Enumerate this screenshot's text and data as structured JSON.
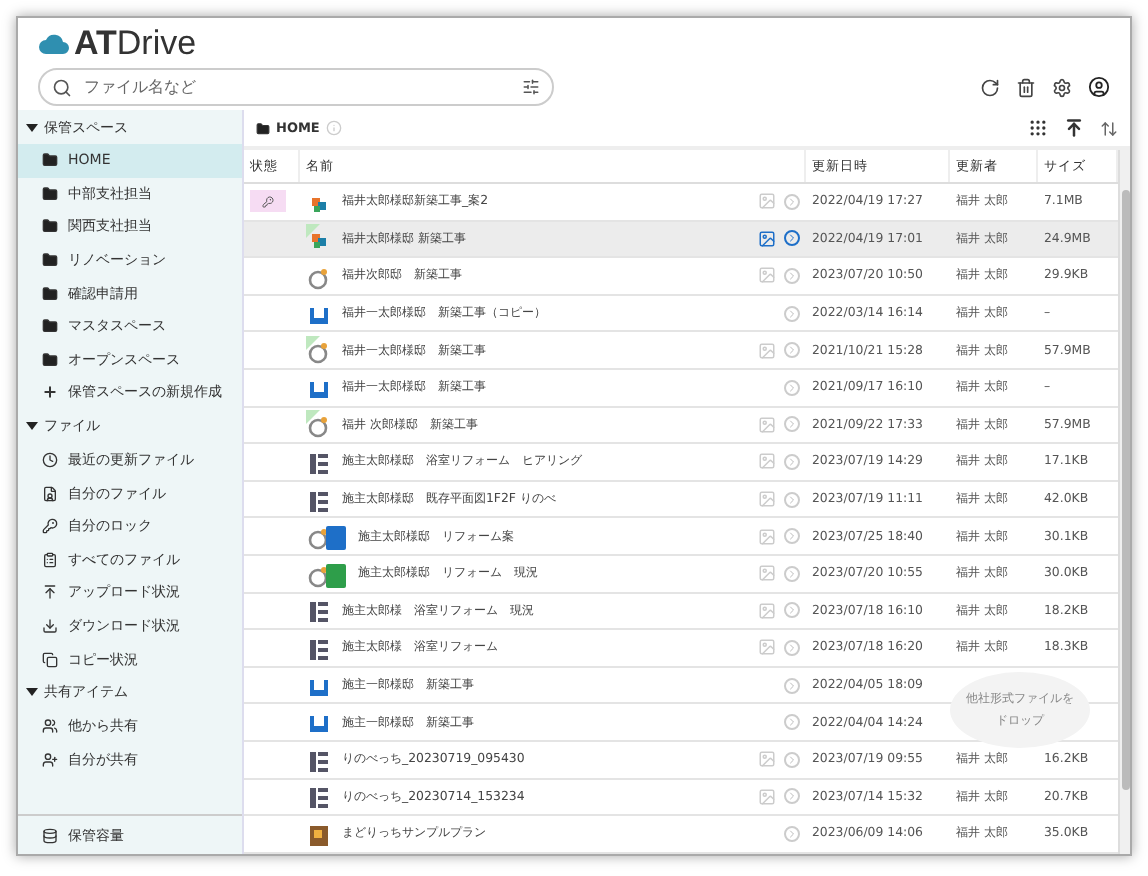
{
  "app": {
    "logo": "ATDrive"
  },
  "search": {
    "placeholder": "ファイル名など"
  },
  "sidebar": {
    "sections": [
      {
        "title": "保管スペース",
        "expanded": true,
        "items": [
          {
            "label": "HOME",
            "kind": "folder",
            "selected": true
          },
          {
            "label": "中部支社担当",
            "kind": "folder",
            "selected": false
          },
          {
            "label": "関西支社担当",
            "kind": "folder",
            "selected": false
          },
          {
            "label": "リノベーション",
            "kind": "folder",
            "selected": false
          },
          {
            "label": "確認申請用",
            "kind": "folder",
            "selected": false
          },
          {
            "label": "マスタスペース",
            "kind": "folder",
            "selected": false
          },
          {
            "label": "オープンスペース",
            "kind": "folder",
            "selected": false
          },
          {
            "label": "保管スペースの新規作成",
            "kind": "add",
            "selected": false
          }
        ]
      },
      {
        "title": "ファイル",
        "expanded": true,
        "items": [
          {
            "label": "最近の更新ファイル",
            "kind": "recent",
            "selected": false
          },
          {
            "label": "自分のファイル",
            "kind": "mine",
            "selected": false
          },
          {
            "label": "自分のロック",
            "kind": "lock",
            "selected": false
          },
          {
            "label": "すべてのファイル",
            "kind": "all",
            "selected": false
          },
          {
            "label": "アップロード状況",
            "kind": "upload",
            "selected": false
          },
          {
            "label": "ダウンロード状況",
            "kind": "download",
            "selected": false
          },
          {
            "label": "コピー状況",
            "kind": "copy",
            "selected": false
          }
        ]
      },
      {
        "title": "共有アイテム",
        "expanded": true,
        "items": [
          {
            "label": "他から共有",
            "kind": "shared-in",
            "selected": false
          },
          {
            "label": "自分が共有",
            "kind": "shared-out",
            "selected": false
          }
        ]
      }
    ],
    "footer": "保管容量"
  },
  "breadcrumb": {
    "label": "HOME"
  },
  "table": {
    "columns": [
      "状態",
      "名前",
      "更新日時",
      "更新者",
      "サイズ"
    ],
    "rows": [
      {
        "name": "福井太郎様邸新築工事_案2",
        "kind": "multi",
        "locked": true,
        "synced": false,
        "thumb": true,
        "selected": false,
        "updated": "2022/04/19 17:27",
        "by": "福井 太郎",
        "size": "7.1MB"
      },
      {
        "name": "福井太郎様邸 新築工事",
        "kind": "multi",
        "locked": false,
        "synced": true,
        "thumb": true,
        "selected": true,
        "updated": "2022/04/19 17:01",
        "by": "福井 太郎",
        "size": "24.9MB"
      },
      {
        "name": "福井次郎邸　新築工事",
        "kind": "ring",
        "locked": false,
        "synced": false,
        "thumb": true,
        "selected": false,
        "updated": "2023/07/20 10:50",
        "by": "福井 太郎",
        "size": "29.9KB"
      },
      {
        "name": "福井一太郎様邸　新築工事（コピー）",
        "kind": "box",
        "locked": false,
        "synced": false,
        "thumb": false,
        "selected": false,
        "updated": "2022/03/14 16:14",
        "by": "福井 太郎",
        "size": "–"
      },
      {
        "name": "福井一太郎様邸　新築工事",
        "kind": "ring",
        "locked": false,
        "synced": true,
        "thumb": true,
        "selected": false,
        "updated": "2021/10/21 15:28",
        "by": "福井 太郎",
        "size": "57.9MB"
      },
      {
        "name": "福井一太郎様邸　新築工事",
        "kind": "box",
        "locked": false,
        "synced": false,
        "thumb": false,
        "selected": false,
        "updated": "2021/09/17 16:10",
        "by": "福井 太郎",
        "size": "–"
      },
      {
        "name": "福井 次郎様邸　新築工事",
        "kind": "ring",
        "locked": false,
        "synced": true,
        "thumb": true,
        "selected": false,
        "updated": "2021/09/22 17:33",
        "by": "福井 太郎",
        "size": "57.9MB"
      },
      {
        "name": "施主太郎様邸　浴室リフォーム　ヒアリング",
        "kind": "grid",
        "locked": false,
        "synced": false,
        "thumb": true,
        "selected": false,
        "updated": "2023/07/19 14:29",
        "by": "福井 太郎",
        "size": "17.1KB"
      },
      {
        "name": "施主太郎様邸　既存平面図1F2F りのべ",
        "kind": "grid",
        "locked": false,
        "synced": false,
        "thumb": true,
        "selected": false,
        "updated": "2023/07/19 11:11",
        "by": "福井 太郎",
        "size": "42.0KB"
      },
      {
        "name": "施主太郎様邸　リフォーム案",
        "kind": "ring",
        "badge": {
          "color": "#1e6fc8"
        },
        "locked": false,
        "synced": false,
        "thumb": true,
        "selected": false,
        "updated": "2023/07/25 18:40",
        "by": "福井 太郎",
        "size": "30.1KB"
      },
      {
        "name": "施主太郎様邸　リフォーム　現況",
        "kind": "ring",
        "badge": {
          "color": "#2e9e4a"
        },
        "locked": false,
        "synced": false,
        "thumb": true,
        "selected": false,
        "updated": "2023/07/20 10:55",
        "by": "福井 太郎",
        "size": "30.0KB"
      },
      {
        "name": "施主太郎様　浴室リフォーム　現況",
        "kind": "grid",
        "locked": false,
        "synced": false,
        "thumb": true,
        "selected": false,
        "updated": "2023/07/18 16:10",
        "by": "福井 太郎",
        "size": "18.2KB"
      },
      {
        "name": "施主太郎様　浴室リフォーム",
        "kind": "grid",
        "locked": false,
        "synced": false,
        "thumb": true,
        "selected": false,
        "updated": "2023/07/18 16:20",
        "by": "福井 太郎",
        "size": "18.3KB"
      },
      {
        "name": "施主一郎様邸　新築工事",
        "kind": "box",
        "locked": false,
        "synced": false,
        "thumb": false,
        "selected": false,
        "updated": "2022/04/05 18:09"
      },
      {
        "name": "施主一郎様邸　新築工事",
        "kind": "box",
        "locked": false,
        "synced": false,
        "thumb": false,
        "selected": false,
        "updated": "2022/04/04 14:24"
      },
      {
        "name": "りのべっち_20230719_095430",
        "kind": "grid",
        "locked": false,
        "synced": false,
        "thumb": true,
        "selected": false,
        "updated": "2023/07/19 09:55",
        "by": "福井 太郎",
        "size": "16.2KB"
      },
      {
        "name": "りのべっち_20230714_153234",
        "kind": "grid",
        "locked": false,
        "synced": false,
        "thumb": true,
        "selected": false,
        "updated": "2023/07/14 15:32",
        "by": "福井 太郎",
        "size": "20.7KB"
      },
      {
        "name": "まどりっちサンプルプラン",
        "kind": "plan",
        "locked": false,
        "synced": false,
        "thumb": false,
        "selected": false,
        "updated": "2023/06/09 14:06",
        "by": "福井 太郎",
        "size": "35.0KB"
      }
    ]
  },
  "drop_zone": {
    "lines": [
      "他社形式ファイルを",
      "ドロップ"
    ]
  }
}
